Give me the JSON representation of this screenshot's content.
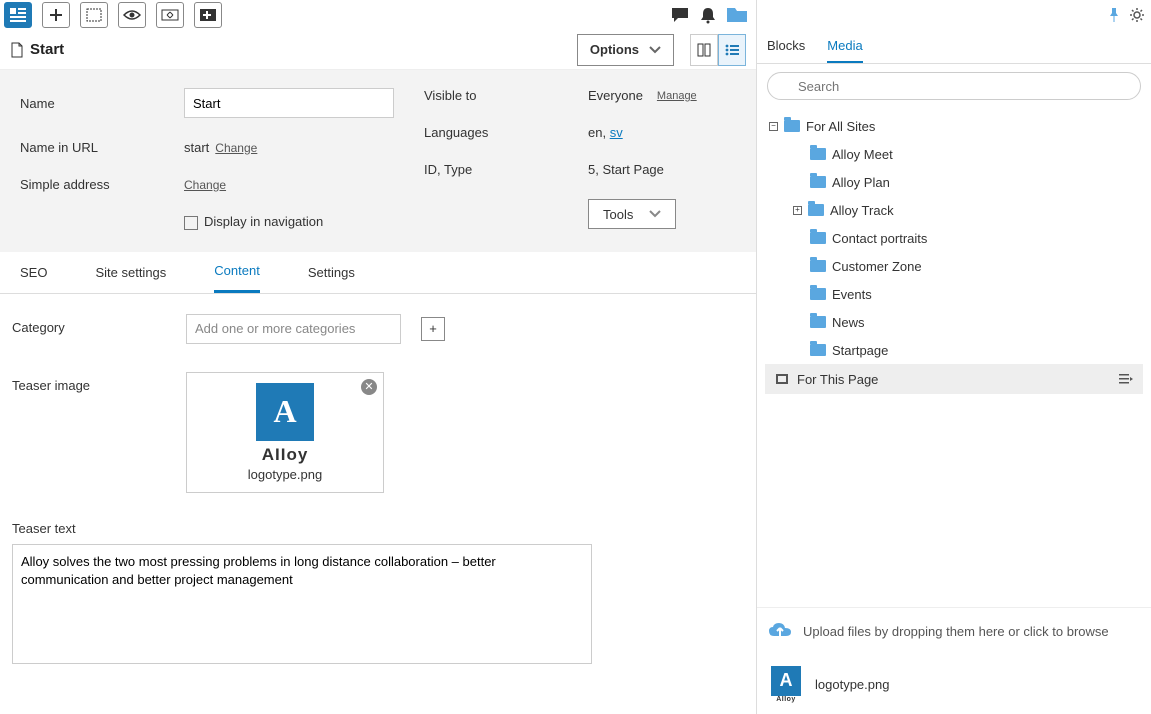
{
  "page_title": "Start",
  "options_label": "Options",
  "summary": {
    "name_label": "Name",
    "name_value": "Start",
    "url_label": "Name in URL",
    "url_value": "start",
    "change": "Change",
    "simple_label": "Simple address",
    "display_nav": "Display in navigation",
    "visible_label": "Visible to",
    "visible_value": "Everyone",
    "manage": "Manage",
    "languages_label": "Languages",
    "lang_en": "en",
    "lang_sv": "sv",
    "idtype_label": "ID, Type",
    "idtype_value": "5, Start Page",
    "tools": "Tools"
  },
  "tabs": {
    "seo": "SEO",
    "site": "Site settings",
    "content": "Content",
    "settings": "Settings"
  },
  "form": {
    "category_label": "Category",
    "category_placeholder": "Add one or more categories",
    "teaser_image_label": "Teaser image",
    "teaser_filename": "logotype.png",
    "logo_word": "AIIoy",
    "teaser_text_label": "Teaser text",
    "teaser_text_value": "Alloy solves the two most pressing problems in long distance collaboration – better communication and better project management"
  },
  "side": {
    "tab_blocks": "Blocks",
    "tab_media": "Media",
    "search_placeholder": "Search",
    "root": "For All Sites",
    "items": [
      "Alloy Meet",
      "Alloy Plan",
      "Alloy Track",
      "Contact portraits",
      "Customer Zone",
      "Events",
      "News",
      "Startpage"
    ],
    "for_this_page": "For This Page",
    "upload_hint": "Upload files by dropping them here or click to browse",
    "file": "logotype.png"
  }
}
